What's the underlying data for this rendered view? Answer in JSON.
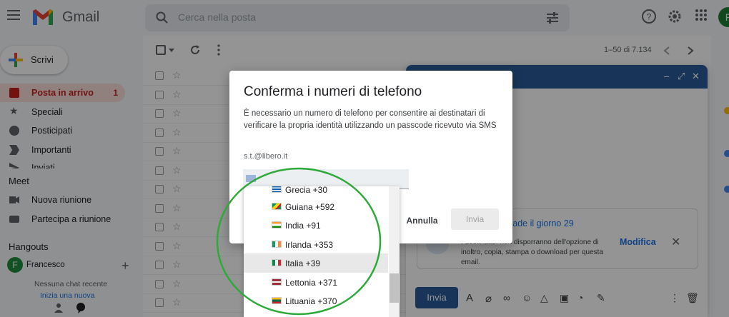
{
  "app": {
    "brand": "Gmail",
    "search_placeholder": "Cerca nella posta",
    "avatar_letter": "F",
    "pager": "1–50 di 7.134"
  },
  "sidebar": {
    "compose_label": "Scrivi",
    "items": [
      {
        "label": "Posta in arrivo",
        "count": "1",
        "icon": "inbox-icon"
      },
      {
        "label": "Speciali",
        "icon": "star-icon"
      },
      {
        "label": "Posticipati",
        "icon": "clock-icon"
      },
      {
        "label": "Importanti",
        "icon": "label-important-icon"
      },
      {
        "label": "Inviati",
        "icon": "send-icon"
      }
    ],
    "meet_title": "Meet",
    "meet_items": [
      {
        "label": "Nuova riunione",
        "icon": "videocam-icon"
      },
      {
        "label": "Partecipa a riunione",
        "icon": "keyboard-icon"
      }
    ],
    "hangouts_title": "Hangouts",
    "hangouts_user": "Francesco",
    "hangouts_avatar": "F",
    "no_chat": "Nessuna chat recente",
    "start_chat": "Inizia una nuova"
  },
  "compose_window": {
    "confidential_title": "cade il giorno 29",
    "confidential_text": "I destinatari non disporranno dell'opzione di inoltro, copia, stampa o download per questa email.",
    "modify_label": "Modifica",
    "send_label": "Invia",
    "header_color": "#2a5c9a"
  },
  "dialog": {
    "title": "Conferma i numeri di telefono",
    "body": "È necessario un numero di telefono per consentire ai destinatari di verificare la propria identità utilizzando un passcode ricevuto via SMS",
    "recipient": "s.t.@libero.it",
    "cancel_label": "Annulla",
    "send_label": "Invia"
  },
  "country_dropdown": {
    "options": [
      {
        "label": "Grecia +30",
        "flag": [
          "#0d5eaf",
          "#ffffff"
        ]
      },
      {
        "label": "Guiana +592",
        "flag": [
          "#009e49",
          "#fcd116"
        ]
      },
      {
        "label": "India +91",
        "flag": [
          "#ff9933",
          "#138808"
        ]
      },
      {
        "label": "Irlanda +353",
        "flag": [
          "#169b62",
          "#ff883e"
        ]
      },
      {
        "label": "Italia +39",
        "flag": [
          "#009246",
          "#ce2b37"
        ]
      },
      {
        "label": "Lettonia +371",
        "flag": [
          "#9e3039",
          "#ffffff"
        ]
      },
      {
        "label": "Lituania +370",
        "flag": [
          "#fdb913",
          "#006a44"
        ]
      }
    ],
    "selected": "Italia +39"
  },
  "annotation": {
    "color": "#2eaa3a"
  }
}
